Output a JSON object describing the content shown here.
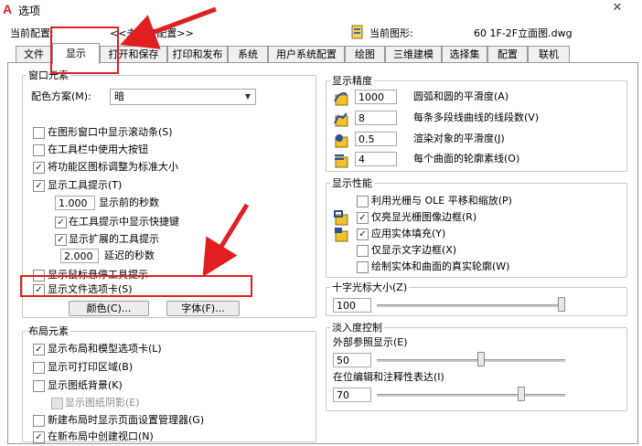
{
  "window": {
    "title": "选项"
  },
  "profile": {
    "label": "当前配置:",
    "value": "<<未命名配置>>"
  },
  "drawing": {
    "label": "当前图形:",
    "value": "60 1F-2F立面图.dwg"
  },
  "tabs": [
    "文件",
    "显示",
    "打开和保存",
    "打印和发布",
    "系统",
    "用户系统配置",
    "绘图",
    "三维建模",
    "选择集",
    "配置",
    "联机"
  ],
  "active_tab": "显示",
  "window_elements": {
    "legend": "窗口元素",
    "color_scheme_label": "配色方案(M):",
    "color_scheme_value": "暗",
    "scrollbars": {
      "label": "在图形窗口中显示滚动条(S)",
      "checked": false
    },
    "large_buttons": {
      "label": "在工具栏中使用大按钮",
      "checked": false
    },
    "resize_icons": {
      "label": "将功能区图标调整为标准大小",
      "checked": true
    },
    "show_tooltips": {
      "label": "显示工具提示(T)",
      "checked": true
    },
    "tooltip_delay": {
      "value": "1.000",
      "label": "显示前的秒数"
    },
    "shortcut_keys": {
      "label": "在工具提示中显示快捷键",
      "checked": true
    },
    "extended_tooltips": {
      "label": "显示扩展的工具提示",
      "checked": true
    },
    "extended_delay": {
      "value": "2.000",
      "label": "延迟的秒数"
    },
    "rollover_tooltips": {
      "label": "显示鼠标悬停工具提示",
      "checked": false
    },
    "file_tabs": {
      "label": "显示文件选项卡(S)",
      "checked": true
    },
    "colors_button": "颜色(C)...",
    "fonts_button": "字体(F)..."
  },
  "layout_elements": {
    "legend": "布局元素",
    "layout_model_tabs": {
      "label": "显示布局和模型选项卡(L)",
      "checked": true
    },
    "printable_area": {
      "label": "显示可打印区域(B)",
      "checked": false
    },
    "paper_background": {
      "label": "显示图纸背景(K)",
      "checked": false
    },
    "paper_shadow": {
      "label": "显示图纸阴影(E)",
      "checked": false
    },
    "page_setup_manager": {
      "label": "新建布局时显示页面设置管理器(G)",
      "checked": false
    },
    "create_viewport": {
      "label": "在新布局中创建视口(N)",
      "checked": true
    }
  },
  "display_resolution": {
    "legend": "显示精度",
    "rows": [
      {
        "value": "1000",
        "label": "圆弧和圆的平滑度(A)"
      },
      {
        "value": "8",
        "label": "每条多段线曲线的线段数(V)"
      },
      {
        "value": "0.5",
        "label": "渲染对象的平滑度(J)"
      },
      {
        "value": "4",
        "label": "每个曲面的轮廓素线(O)"
      }
    ]
  },
  "display_performance": {
    "legend": "显示性能",
    "raster_ole": {
      "label": "利用光栅与 OLE 平移和缩放(P)",
      "checked": false
    },
    "raster_frame": {
      "label": "仅亮显光栅图像边框(R)",
      "checked": true
    },
    "solid_fill": {
      "label": "应用实体填充(Y)",
      "checked": true
    },
    "text_boundary": {
      "label": "仅显示文字边框(X)",
      "checked": false
    },
    "true_silhouettes": {
      "label": "绘制实体和曲面的真实轮廓(W)",
      "checked": false
    }
  },
  "crosshair": {
    "legend": "十字光标大小(Z)",
    "value": "100",
    "level": 100
  },
  "fade_control": {
    "legend": "淡入度控制",
    "xref_label": "外部参照显示(E)",
    "xref_value": "50",
    "xref_level": 50,
    "inplace_label": "在位编辑和注释性表达(I)",
    "inplace_value": "70",
    "inplace_level": 70
  },
  "colors": {
    "annotation": "#e02020",
    "check": "#1a1a1a"
  }
}
